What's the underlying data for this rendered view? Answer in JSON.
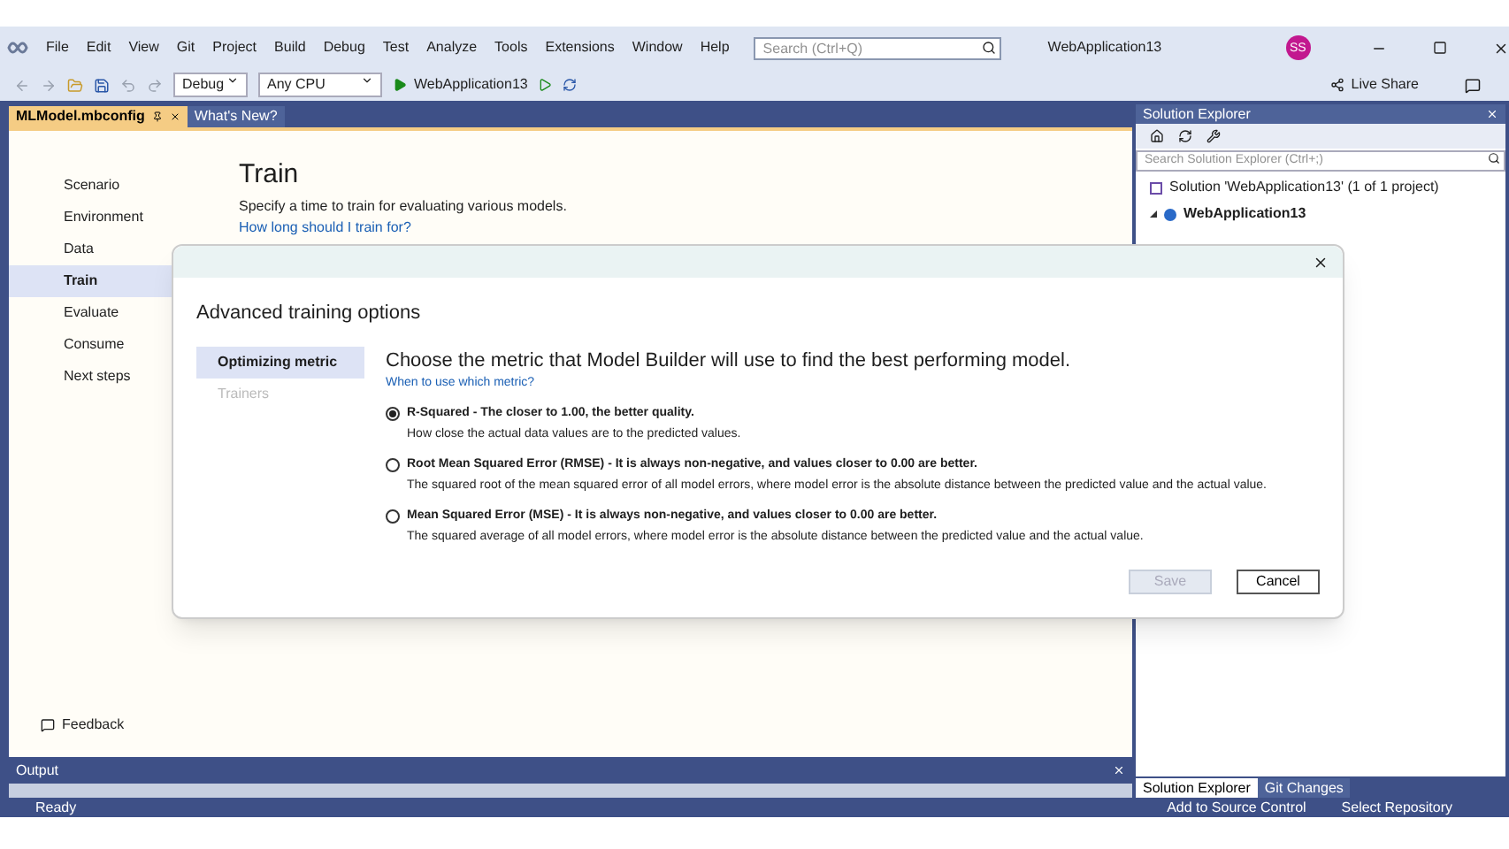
{
  "menu": [
    "File",
    "Edit",
    "View",
    "Git",
    "Project",
    "Build",
    "Debug",
    "Test",
    "Analyze",
    "Tools",
    "Extensions",
    "Window",
    "Help"
  ],
  "search": {
    "placeholder": "Search (Ctrl+Q)"
  },
  "window": {
    "title": "WebApplication13",
    "avatar": "SS"
  },
  "toolbar": {
    "configuration": "Debug",
    "platform": "Any CPU",
    "run_target": "WebApplication13",
    "live_share": "Live Share"
  },
  "doc_tabs": [
    {
      "label": "MLModel.mbconfig",
      "selected": true
    },
    {
      "label": "What's New?",
      "selected": false
    }
  ],
  "steps": [
    {
      "label": "Scenario",
      "selected": false
    },
    {
      "label": "Environment",
      "selected": false
    },
    {
      "label": "Data",
      "selected": false
    },
    {
      "label": "Train",
      "selected": true
    },
    {
      "label": "Evaluate",
      "selected": false
    },
    {
      "label": "Consume",
      "selected": false
    },
    {
      "label": "Next steps",
      "selected": false
    }
  ],
  "page": {
    "title": "Train",
    "description": "Specify a time to train for evaluating various models.",
    "link": "How long should I train for?",
    "feedback": "Feedback"
  },
  "dialog": {
    "title": "Advanced training options",
    "tabs": [
      {
        "label": "Optimizing metric",
        "selected": true,
        "disabled": false
      },
      {
        "label": "Trainers",
        "selected": false,
        "disabled": true
      }
    ],
    "heading": "Choose the metric that Model Builder will use to find the best performing model.",
    "link": "When to use which metric?",
    "options": [
      {
        "label": "R-Squared - The closer to 1.00, the better quality.",
        "description": "How close the actual data values are to the predicted values.",
        "selected": true
      },
      {
        "label": "Root Mean Squared Error (RMSE) - It is always non-negative, and values closer to 0.00 are better.",
        "description": "The squared root of the mean squared error of all model errors, where model error is the absolute distance between the predicted value and the actual value.",
        "selected": false
      },
      {
        "label": "Mean Squared Error (MSE) - It is always non-negative, and values closer to 0.00 are better.",
        "description": "The squared average of all model errors, where model error is the absolute distance between the predicted value and the actual value.",
        "selected": false
      }
    ],
    "buttons": [
      {
        "label": "Save",
        "disabled": true
      },
      {
        "label": "Cancel",
        "disabled": false
      }
    ]
  },
  "solution_explorer": {
    "title": "Solution Explorer",
    "search": {
      "placeholder": "Search Solution Explorer (Ctrl+;)"
    },
    "solution": "Solution 'WebApplication13' (1 of 1 project)",
    "project": "WebApplication13",
    "tabs": [
      {
        "label": "Solution Explorer",
        "selected": true
      },
      {
        "label": "Git Changes",
        "selected": false
      }
    ]
  },
  "output": {
    "title": "Output"
  },
  "status_bar": {
    "left": "Ready",
    "items": [
      "Add to Source Control",
      "Select Repository"
    ]
  }
}
